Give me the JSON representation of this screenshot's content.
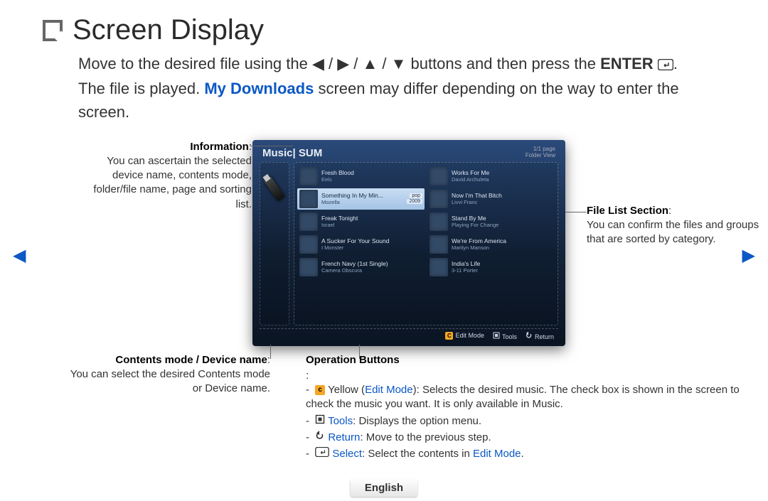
{
  "title": "Screen Display",
  "intro": {
    "line1a": "Move to the desired file using the ",
    "arrows": "◀ / ▶ / ▲ / ▼",
    "line1b": " buttons and then press the ",
    "enter": "ENTER",
    "enter_icon": "E",
    "line2a": ". The file is played. ",
    "mydl": "My Downloads",
    "line2b": " screen may differ depending on the way to enter the screen."
  },
  "tv": {
    "title": "Music",
    "title_sub": "| SUM",
    "page": "1/1 page",
    "view": "Folder View",
    "left": [
      {
        "name": "Fresh Blood",
        "artist": "Eels"
      },
      {
        "name": "Something In My Min...",
        "artist": "Mozella",
        "tag1": "pop",
        "tag2": "2009",
        "sel": true
      },
      {
        "name": "Freak Tonight",
        "artist": "Israel"
      },
      {
        "name": "A Sucker For Your Sound",
        "artist": "I Monster"
      },
      {
        "name": "French Navy (1st Single)",
        "artist": "Camera Obscura"
      }
    ],
    "right": [
      {
        "name": "Works For Me",
        "artist": "David Archuleta"
      },
      {
        "name": "Now I'm That Bitch",
        "artist": "Livvi Franc"
      },
      {
        "name": "Stand By Me",
        "artist": "Playing For Change"
      },
      {
        "name": "We're From America",
        "artist": "Marilyn Manson"
      },
      {
        "name": "India's Life",
        "artist": "3-11 Porter"
      }
    ],
    "foot": {
      "edit": "Edit Mode",
      "tools": "Tools",
      "return": "Return",
      "c": "C"
    }
  },
  "callouts": {
    "info_hd": "Information",
    "info_body": "You can ascertain the selected device name, contents mode, folder/file name, page and sorting list.",
    "contents_hd": "Contents mode / Device name",
    "contents_body": "You can select the desired Contents mode or Device name.",
    "filelist_hd": "File List Section",
    "filelist_body": "You can confirm the files and groups that are sorted by category.",
    "op_hd": "Operation Buttons",
    "op1a": "Yellow (",
    "op1_link": "Edit Mode",
    "op1b": "): Selects the desired music. The check box is shown in the screen to check the music you want. It is only available in Music.",
    "op2_link": "Tools",
    "op2": ": Displays the option menu.",
    "op3_link": "Return",
    "op3": ": Move to the previous step.",
    "op4_link": "Select",
    "op4a": ": Select the contents in ",
    "op4_link2": "Edit Mode",
    "op4b": "."
  },
  "footer_lang": "English",
  "icons": {
    "c_key": "c",
    "tools_sym": "T",
    "return_sym": "R",
    "select_sym": "E"
  }
}
